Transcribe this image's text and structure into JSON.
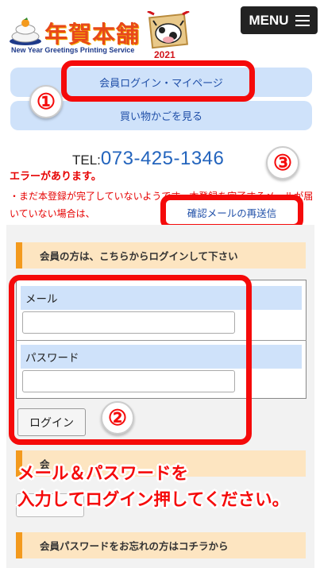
{
  "header": {
    "logo_title": "年賀本舗",
    "logo_subtitle": "New Year Greetings Printing Service",
    "logo_year": "2021",
    "menu_label": "MENU"
  },
  "nav": {
    "login_label": "会員ログイン・マイページ",
    "cart_label": "買い物かごを見る"
  },
  "contact": {
    "tel_label": "TEL:",
    "tel_number": "073-425-1346"
  },
  "error": {
    "title": "エラーがあります。",
    "message": "・まだ本登録が完了していないようです。本登録を完了するメールが届いていない場合は、",
    "resend_link": "確認メールの再送信"
  },
  "login_section": {
    "heading": "会員の方は、こちらからログインして下さい",
    "email_label": "メール",
    "email_value": "",
    "password_label": "パスワード",
    "password_value": "",
    "login_button": "ログイン"
  },
  "register_section": {
    "heading": "会"
  },
  "forgot_section": {
    "heading": "会員パスワードをお忘れの方はコチラから"
  },
  "annotations": {
    "badge_1": "①",
    "badge_2": "②",
    "badge_3": "③",
    "instruction_line1": "メール＆パスワードを",
    "instruction_line2": "入力してログイン押してください。",
    "color": "#f50a0a"
  },
  "colors": {
    "nav_button_bg": "#cfe2fa",
    "link_blue": "#1f4fa8",
    "tel_blue": "#2364bd",
    "section_head_bg": "#fde5c1",
    "section_head_accent": "#f39a1e",
    "error_red": "#e60000"
  }
}
